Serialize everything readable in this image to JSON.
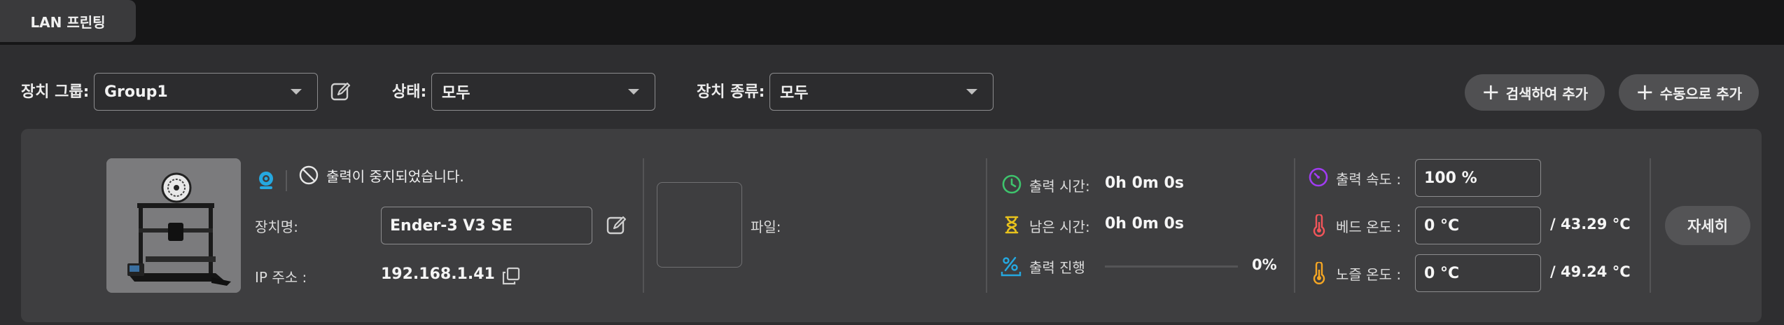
{
  "tab": {
    "label": "LAN 프린팅"
  },
  "filters": {
    "group_label": "장치 그룹:",
    "group_value": "Group1",
    "status_label": "상태:",
    "status_value": "모두",
    "type_label": "장치 종류:",
    "type_value": "모두",
    "search_add_label": "검색하여 추가",
    "manual_add_label": "수동으로 추가"
  },
  "device": {
    "status_text": "출력이 중지되었습니다.",
    "name_label": "장치명:",
    "name_value": "Ender-3 V3 SE",
    "ip_label": "IP 주소 :",
    "ip_value": "192.168.1.41",
    "file_label": "파일:",
    "print_time_label": "출력 시간:",
    "print_time_value": "0h 0m 0s",
    "remaining_label": "남은 시간:",
    "remaining_value": "0h 0m 0s",
    "progress_label": "출력 진행",
    "progress_value": "0%",
    "progress_fraction": 0,
    "speed_label": "출력 속도 :",
    "speed_value": "100 %",
    "bed_temp_label": "베드 온도 :",
    "bed_temp_value": "0 °C",
    "bed_temp_target": "/ 43.29 °C",
    "nozzle_temp_label": "노즐 온도 :",
    "nozzle_temp_value": "0 °C",
    "nozzle_temp_target": "/ 49.24 °C",
    "detail_label": "자세히"
  },
  "colors": {
    "accent_blue": "#25a8e0",
    "clock_green": "#3ec46d",
    "hourglass_yellow": "#e8c21c",
    "speed_purple": "#a13cf2",
    "bed_red": "#f2555a",
    "nozzle_orange": "#f5a623"
  },
  "icons": [
    "edit-icon",
    "plus-icon",
    "camera-icon",
    "ban-icon",
    "copy-icon",
    "clock-icon",
    "hourglass-icon",
    "progress-icon",
    "speed-icon",
    "bed-temp-icon",
    "nozzle-temp-icon"
  ]
}
